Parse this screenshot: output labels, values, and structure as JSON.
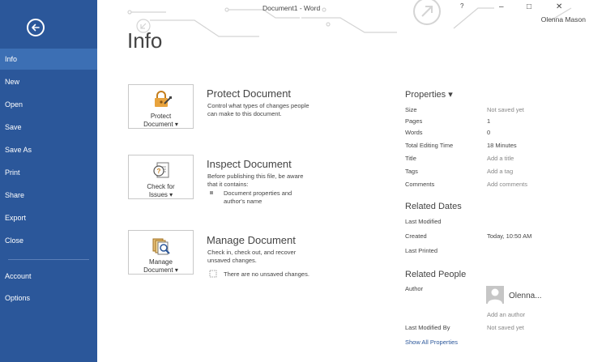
{
  "window": {
    "title": "Document1 - Word",
    "help": "?",
    "minimize": "–",
    "maximize": "□",
    "close": "✕",
    "user": "Olenna Mason"
  },
  "colors": {
    "accent": "#2b579a",
    "active_nav": "#3c6fb4",
    "link": "#2b579a"
  },
  "sidebar": {
    "back_icon": "back-arrow-icon",
    "items": [
      {
        "label": "Info",
        "active": true
      },
      {
        "label": "New"
      },
      {
        "label": "Open"
      },
      {
        "label": "Save"
      },
      {
        "label": "Save As"
      },
      {
        "label": "Print"
      },
      {
        "label": "Share"
      },
      {
        "label": "Export"
      },
      {
        "label": "Close"
      },
      {
        "label": "Account"
      },
      {
        "label": "Options"
      }
    ]
  },
  "main": {
    "title": "Info",
    "sections": [
      {
        "button_label": [
          "Protect",
          "Document ▾"
        ],
        "icon": "lock-key-icon",
        "heading": "Protect Document",
        "description": [
          "Control what types of changes people",
          "can make to this document."
        ]
      },
      {
        "button_label": [
          "Check for",
          "Issues ▾"
        ],
        "icon": "inspect-document-icon",
        "heading": "Inspect Document",
        "description": [
          "Before publishing this file, be aware",
          "that it contains:"
        ],
        "bullet": [
          "Document properties and",
          "author's name"
        ]
      },
      {
        "button_label": [
          "Manage",
          "Document ▾"
        ],
        "icon": "manage-versions-icon",
        "heading": "Manage Document",
        "description": [
          "Check in, check out, and recover",
          "unsaved changes."
        ],
        "note": "There are no unsaved changes."
      }
    ]
  },
  "properties": {
    "heading": "Properties ▾",
    "rows": [
      {
        "key": "Size",
        "value": "Not saved yet",
        "grey": true
      },
      {
        "key": "Pages",
        "value": "1"
      },
      {
        "key": "Words",
        "value": "0"
      },
      {
        "key": "Total Editing Time",
        "value": "18 Minutes"
      },
      {
        "key": "Title",
        "value": "Add a title",
        "grey": true
      },
      {
        "key": "Tags",
        "value": "Add a tag",
        "grey": true
      },
      {
        "key": "Comments",
        "value": "Add comments",
        "grey": true
      }
    ],
    "related_dates": {
      "heading": "Related Dates",
      "rows": [
        {
          "key": "Last Modified",
          "value": ""
        },
        {
          "key": "Created",
          "value": "Today, 10:50 AM"
        },
        {
          "key": "Last Printed",
          "value": ""
        }
      ]
    },
    "related_people": {
      "heading": "Related People",
      "author_key": "Author",
      "author_name": "Olenna...",
      "add_author": "Add an author",
      "last_modified_by_key": "Last Modified By",
      "last_modified_by_value": "Not saved yet",
      "show_all": "Show All Properties"
    }
  }
}
